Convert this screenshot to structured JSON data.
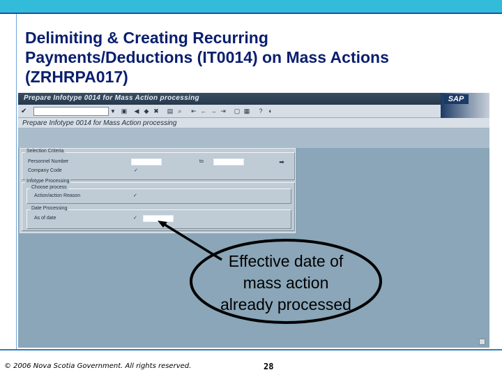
{
  "slide": {
    "title": "Delimiting & Creating Recurring Payments/Deductions (IT0014) on Mass Actions (ZRHRPA017)",
    "copyright": "© 2006 Nova Scotia Government. All rights reserved.",
    "page_number": "28"
  },
  "sap": {
    "window_title": "Prepare Infotype 0014 for Mass Action processing",
    "logo": "SAP",
    "screen_title": "Prepare Infotype 0014 for Mass Action processing",
    "toolbar_icons": [
      "check-icon",
      "back-icon",
      "exit-icon",
      "cancel-icon",
      "print-icon",
      "find-icon",
      "first-page-icon",
      "prev-page-icon",
      "next-page-icon",
      "last-page-icon",
      "new-session-icon",
      "shortcut-icon",
      "help-icon",
      "layout-icon"
    ],
    "groups": {
      "selection_criteria": "Selection Criteria",
      "infotype_processing": "Infotype Processing",
      "choose_process": "Choose process",
      "date_processing": "Date Processing"
    },
    "fields": {
      "personnel_number": "Personnel Number",
      "to_label": "to",
      "company_code": "Company Code",
      "action_reason": "Action/action Reason",
      "as_of_date": "As of date"
    },
    "required_mark": "✓"
  },
  "callout": {
    "line1": "Effective date of",
    "line2": "mass action",
    "line3": "already processed"
  },
  "colors": {
    "title": "#0a1e6e",
    "top_band": "#33bcd9",
    "sap_background": "#8aa6b8"
  }
}
